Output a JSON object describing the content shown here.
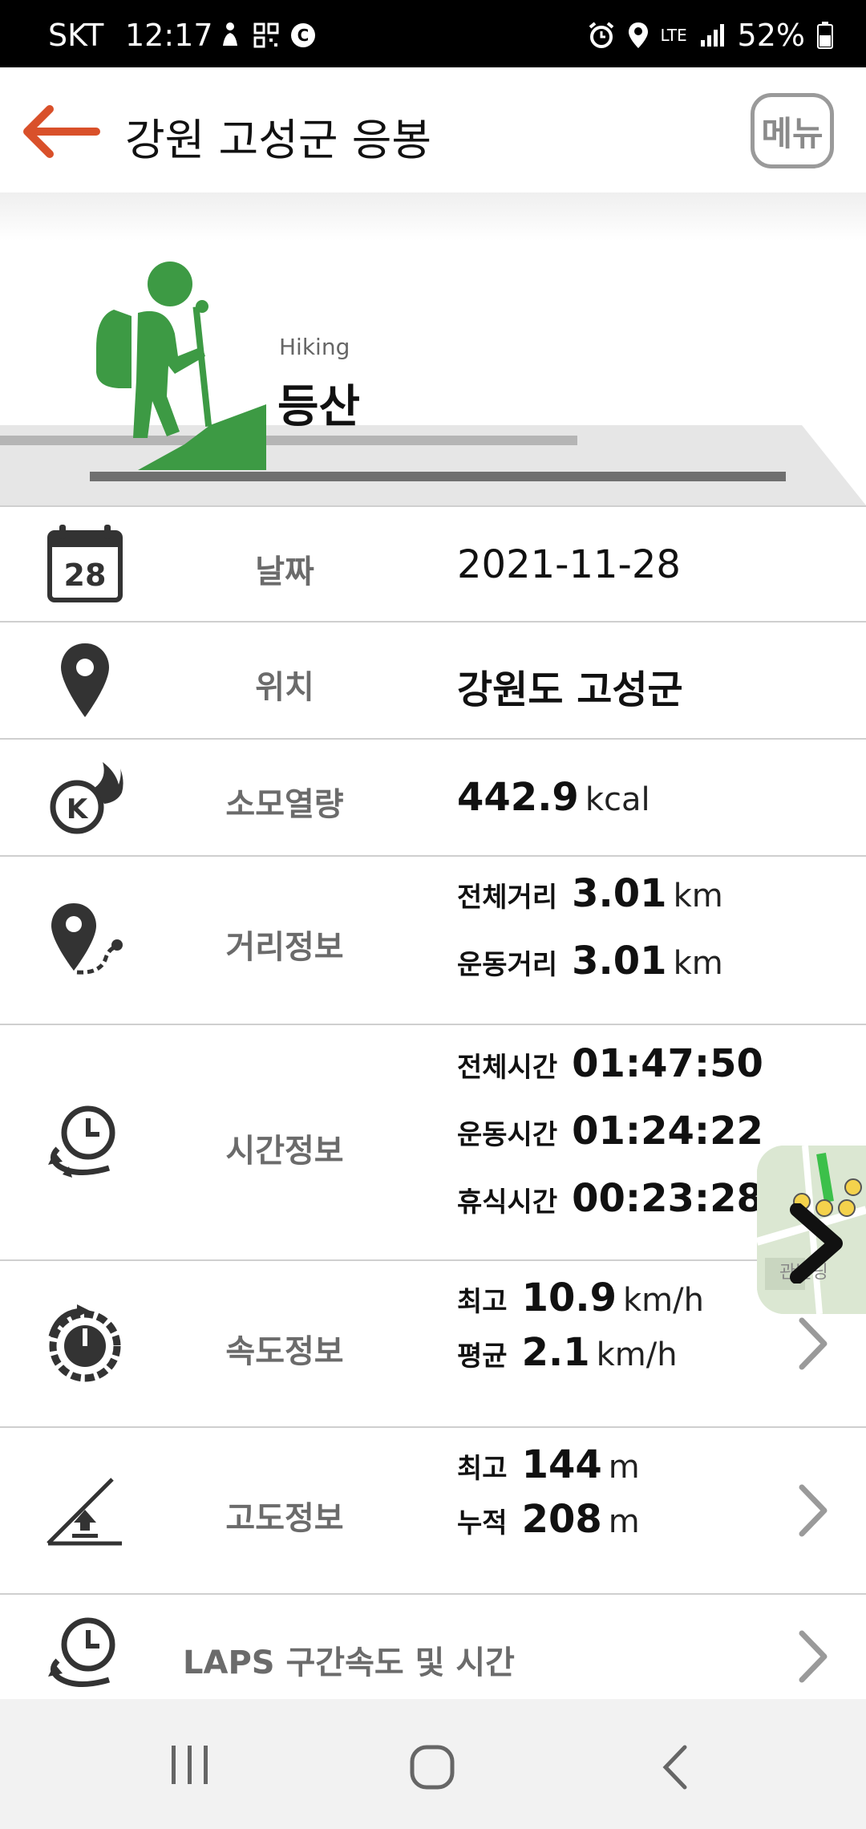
{
  "status_bar": {
    "carrier": "SKT",
    "time": "12:17",
    "network": "LTE",
    "battery": "52%"
  },
  "header": {
    "title": "강원 고성군 응봉",
    "menu_label": "메뉴"
  },
  "activity": {
    "subtitle": "Hiking",
    "title": "등산"
  },
  "rows": {
    "date": {
      "label": "날짜",
      "value": "2021-11-28",
      "calendar_day": "28"
    },
    "location": {
      "label": "위치",
      "value": "강원도 고성군"
    },
    "calories": {
      "label": "소모열량",
      "value": "442.9",
      "unit": "kcal"
    },
    "distance": {
      "label": "거리정보",
      "total_label": "전체거리",
      "total_value": "3.01",
      "total_unit": "km",
      "exercise_label": "운동거리",
      "exercise_value": "3.01",
      "exercise_unit": "km"
    },
    "time": {
      "label": "시간정보",
      "total_label": "전체시간",
      "total_value": "01:47:50",
      "exercise_label": "운동시간",
      "exercise_value": "01:24:22",
      "rest_label": "휴식시간",
      "rest_value": "00:23:28"
    },
    "speed": {
      "label": "속도정보",
      "max_label": "최고",
      "max_value": "10.9",
      "max_unit": "km/h",
      "avg_label": "평균",
      "avg_value": "2.1",
      "avg_unit": "km/h"
    },
    "altitude": {
      "label": "고도정보",
      "max_label": "최고",
      "max_value": "144",
      "max_unit": "m",
      "cum_label": "누적",
      "cum_value": "208",
      "cum_unit": "m"
    },
    "laps": {
      "label": "LAPS 구간속도 및 시간"
    }
  },
  "map_thumb": {
    "text": "관빌딩"
  },
  "colors": {
    "accent": "#d9502a",
    "hiker_green": "#3d9a44",
    "label_gray": "#6b6b6b",
    "divider": "#cfcfcf"
  },
  "icons": [
    "back-arrow-icon",
    "calendar-icon",
    "location-pin-icon",
    "calorie-flame-icon",
    "route-pin-icon",
    "clock-loop-icon",
    "speedometer-icon",
    "altitude-icon",
    "laps-clock-icon",
    "chevron-right-icon"
  ]
}
